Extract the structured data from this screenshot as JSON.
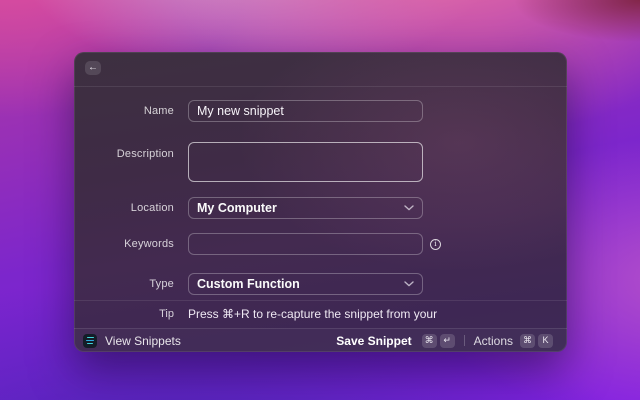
{
  "window": {
    "header": {
      "back_glyph": "←"
    },
    "form": {
      "name": {
        "label": "Name",
        "value": "My new snippet"
      },
      "description": {
        "label": "Description",
        "value": ""
      },
      "location": {
        "label": "Location",
        "value": "My Computer"
      },
      "keywords": {
        "label": "Keywords",
        "value": "",
        "info_glyph": "i"
      },
      "type": {
        "label": "Type",
        "value": "Custom Function"
      },
      "tip": {
        "label": "Tip",
        "text": "Press ⌘+R to re-capture the snippet from your"
      }
    },
    "footer": {
      "view_snippets_label": "View Snippets",
      "save": {
        "label": "Save Snippet",
        "keys": [
          "⌘",
          "↵"
        ]
      },
      "actions": {
        "label": "Actions",
        "keys": [
          "⌘",
          "K"
        ]
      }
    }
  },
  "colors": {
    "accent_teal": "#3fd4da",
    "accent_blue": "#2ea9e0",
    "window_top": "#3d3040",
    "window_bottom": "#3d2a56",
    "wallpaper_pink": "#e76da6",
    "wallpaper_purple": "#7a1fd8"
  }
}
